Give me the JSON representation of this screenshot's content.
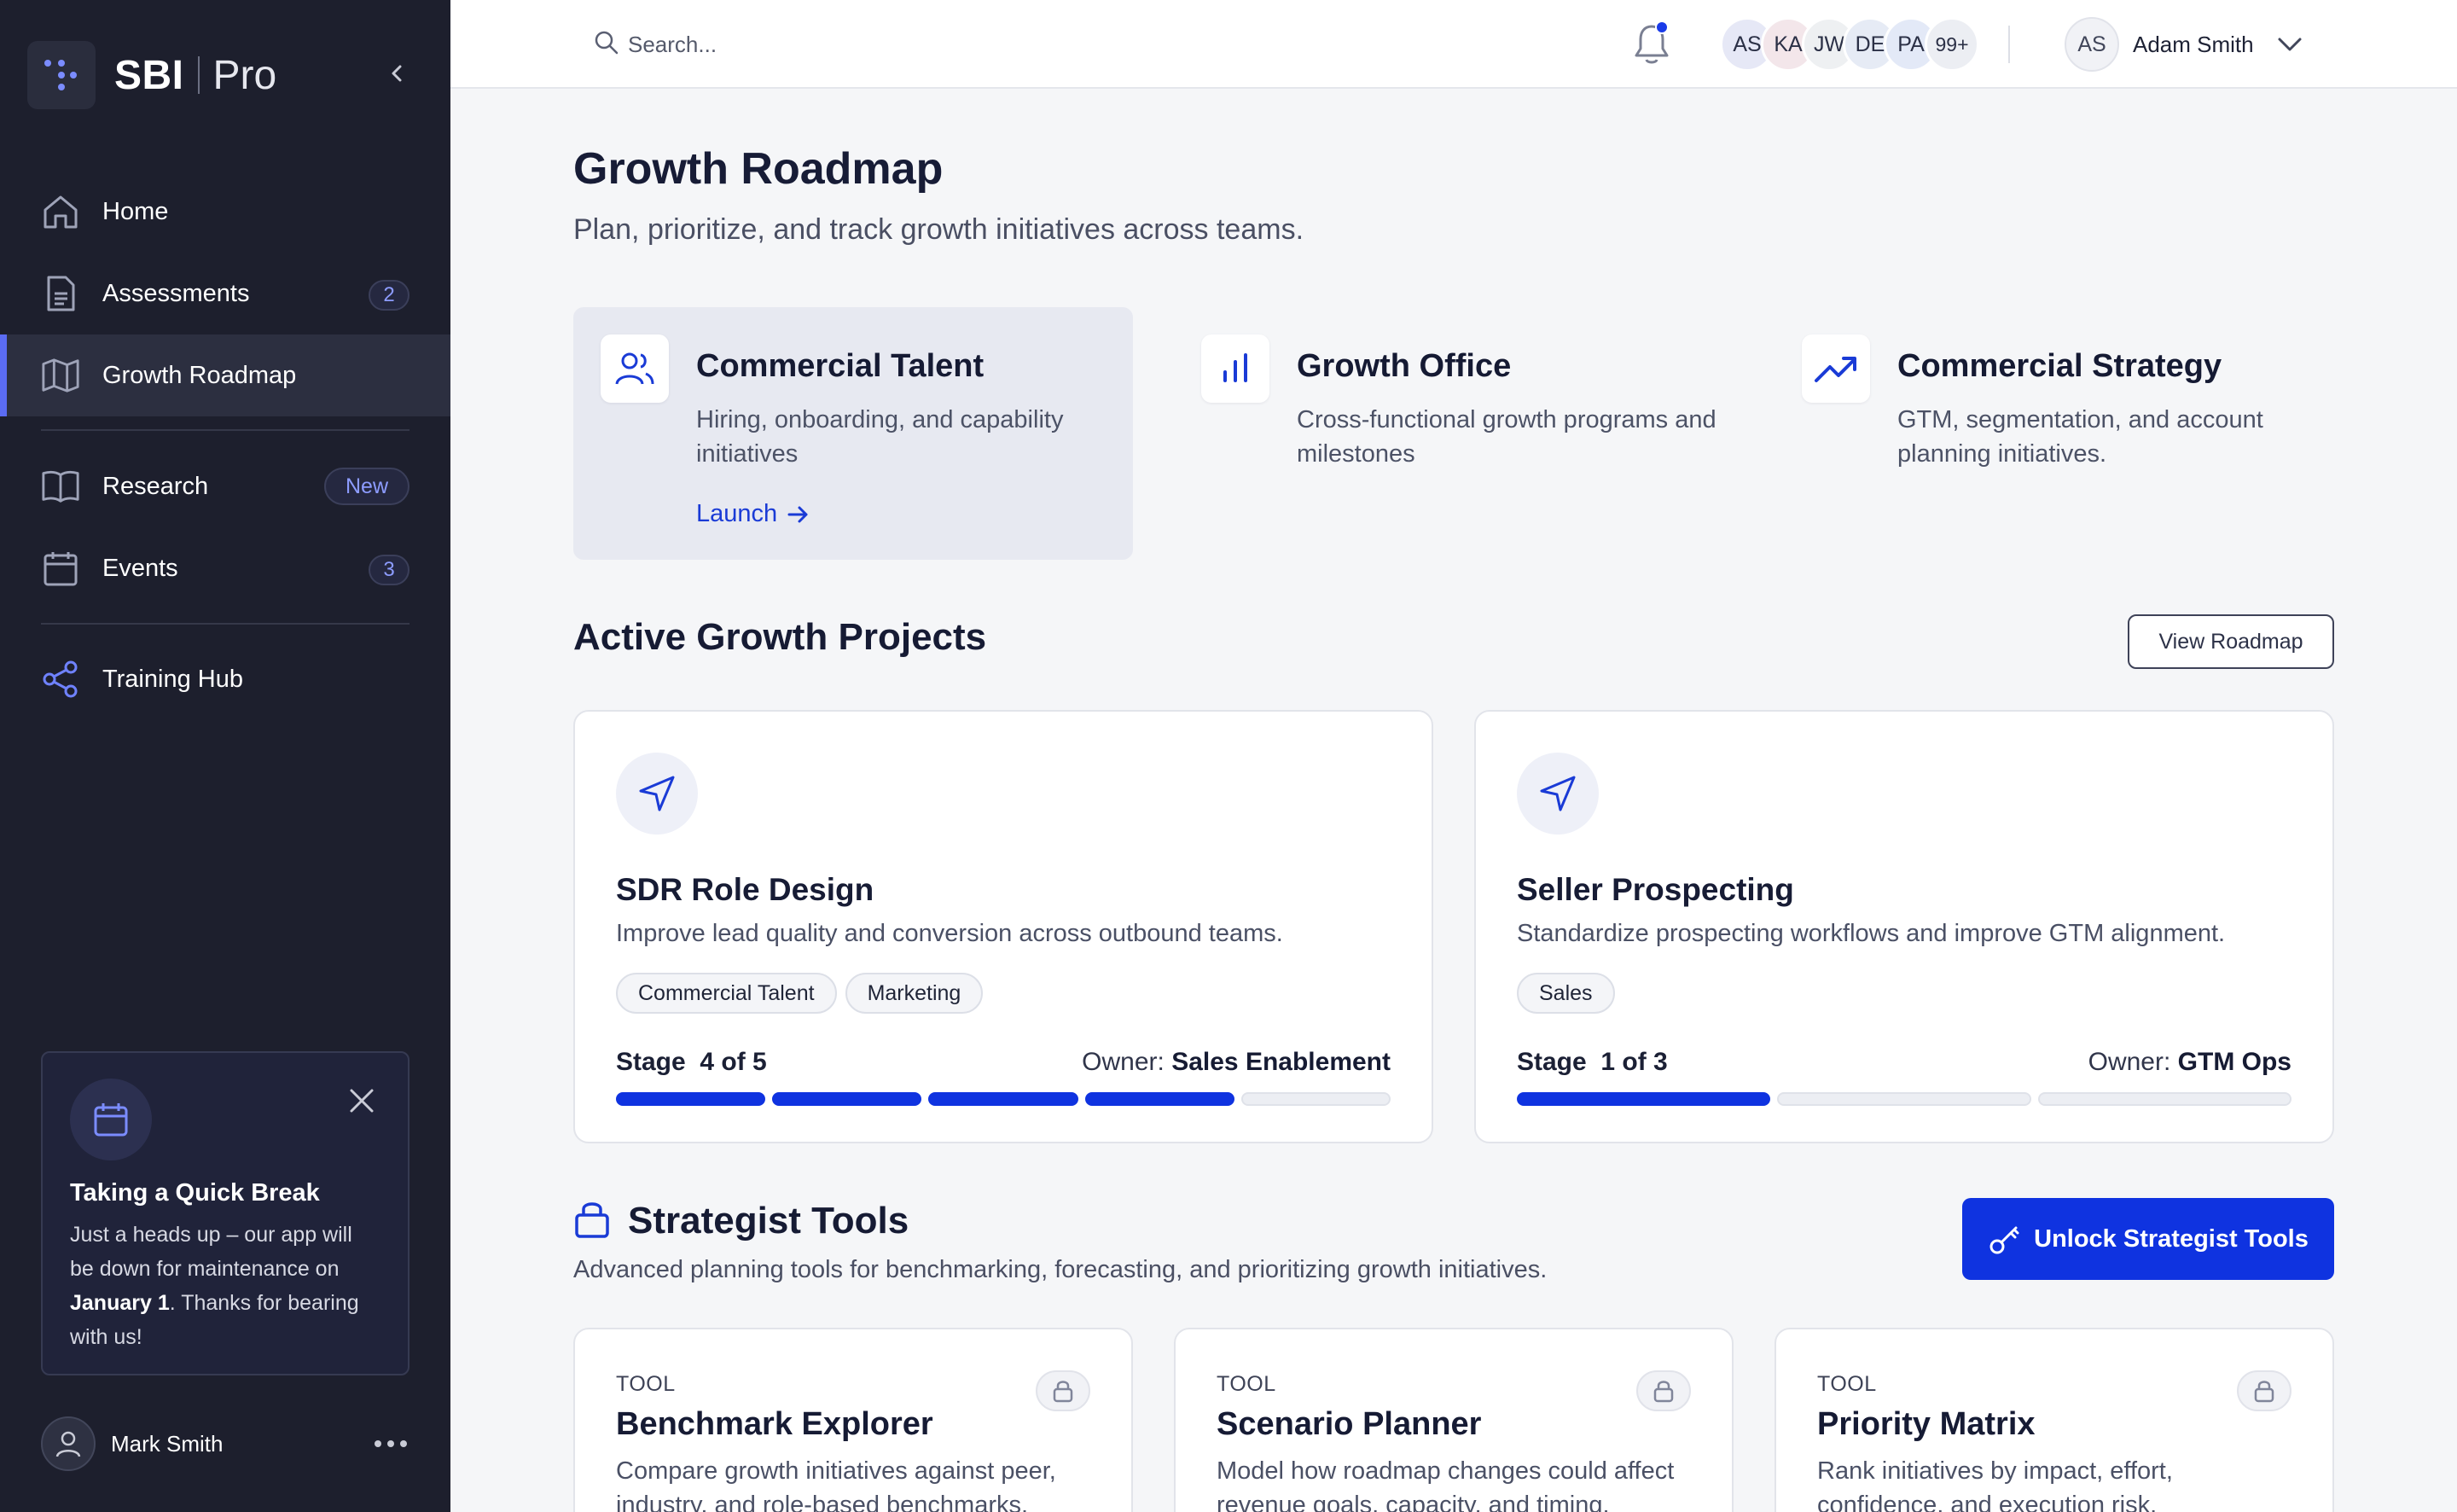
{
  "brand": {
    "name": "SBI",
    "suffix": "Pro"
  },
  "sidebar": {
    "items": [
      {
        "label": "Home",
        "icon": "home-icon"
      },
      {
        "label": "Assessments",
        "icon": "document-icon",
        "badge": "2"
      },
      {
        "label": "Growth Roadmap",
        "icon": "map-icon",
        "active": true
      },
      {
        "label": "Research",
        "icon": "book-icon",
        "badge": "New"
      },
      {
        "label": "Events",
        "icon": "calendar-icon",
        "badge": "3"
      },
      {
        "label": "Training Hub",
        "icon": "share-icon"
      }
    ],
    "notice": {
      "title": "Taking a Quick Break",
      "body_before": "Just a heads up – our app will be down for maintenance on ",
      "body_bold": "January 1",
      "body_after": ". Thanks for bearing with us!"
    },
    "user": {
      "name": "Mark Smith"
    }
  },
  "topbar": {
    "search_placeholder": "Search...",
    "avatars": [
      {
        "initials": "AS",
        "color": "#e6e8f6"
      },
      {
        "initials": "KA",
        "color": "#f3e6ea"
      },
      {
        "initials": "JW",
        "color": "#eef0f2"
      },
      {
        "initials": "DE",
        "color": "#e6ebf5"
      },
      {
        "initials": "PA",
        "color": "#e3e9f7"
      },
      {
        "initials": "99+",
        "color": "#eceef3"
      }
    ],
    "user": {
      "initials": "AS",
      "name": "Adam Smith"
    }
  },
  "page": {
    "title": "Growth Roadmap",
    "subtitle": "Plan, prioritize, and track growth initiatives across teams."
  },
  "features": [
    {
      "title": "Commercial Talent",
      "desc": "Hiring, onboarding, and capability initiatives",
      "link": "Launch"
    },
    {
      "title": "Growth Office",
      "desc": "Cross-functional growth programs and milestones"
    },
    {
      "title": "Commercial Strategy",
      "desc": "GTM, segmentation, and account planning initiatives."
    }
  ],
  "projects_section": {
    "title": "Active Growth Projects",
    "button": "View Roadmap"
  },
  "projects": [
    {
      "title": "SDR Role Design",
      "desc": "Improve lead quality and conversion across outbound teams.",
      "tags": [
        "Commercial Talent",
        "Marketing"
      ],
      "stage_label": "Stage",
      "stage_text": "4 of 5",
      "stage_current": 4,
      "stage_total": 5,
      "owner_label": "Owner:",
      "owner": "Sales Enablement"
    },
    {
      "title": "Seller Prospecting",
      "desc": "Standardize prospecting workflows and improve GTM alignment.",
      "tags": [
        "Sales"
      ],
      "stage_label": "Stage",
      "stage_text": "1 of 3",
      "stage_current": 1,
      "stage_total": 3,
      "owner_label": "Owner:",
      "owner": "GTM Ops"
    }
  ],
  "tools_section": {
    "title": "Strategist Tools",
    "desc": "Advanced planning tools for benchmarking, forecasting, and prioritizing growth initiatives.",
    "button": "Unlock Strategist Tools"
  },
  "tools": [
    {
      "kicker": "TOOL",
      "title": "Benchmark Explorer",
      "desc": "Compare growth initiatives against peer, industry, and role-based benchmarks."
    },
    {
      "kicker": "TOOL",
      "title": "Scenario Planner",
      "desc": "Model how roadmap changes could affect revenue goals, capacity, and timing."
    },
    {
      "kicker": "TOOL",
      "title": "Priority Matrix",
      "desc": "Rank initiatives by impact, effort, confidence, and execution risk."
    }
  ],
  "colors": {
    "accent": "#0f33e0",
    "sidebar_bg": "#1d1f2d",
    "badge_text": "#8d9cff"
  }
}
